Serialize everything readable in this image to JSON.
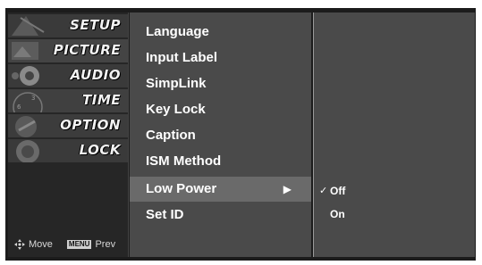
{
  "categories": [
    {
      "label": "SETUP"
    },
    {
      "label": "PICTURE"
    },
    {
      "label": "AUDIO"
    },
    {
      "label": "TIME"
    },
    {
      "label": "OPTION"
    },
    {
      "label": "LOCK"
    }
  ],
  "footer": {
    "move_label": "Move",
    "menu_key": "MENU",
    "prev_label": "Prev"
  },
  "options": [
    {
      "label": "Language"
    },
    {
      "label": "Input Label"
    },
    {
      "label": "SimpLink"
    },
    {
      "label": "Key Lock"
    },
    {
      "label": "Caption"
    },
    {
      "label": "ISM Method"
    },
    {
      "label": "Low Power"
    },
    {
      "label": "Set ID"
    }
  ],
  "selected_option_arrow": "▶",
  "submenu": {
    "items": [
      {
        "label": "Off",
        "checked": true
      },
      {
        "label": "On",
        "checked": false
      }
    ],
    "check_mark": "✓"
  }
}
